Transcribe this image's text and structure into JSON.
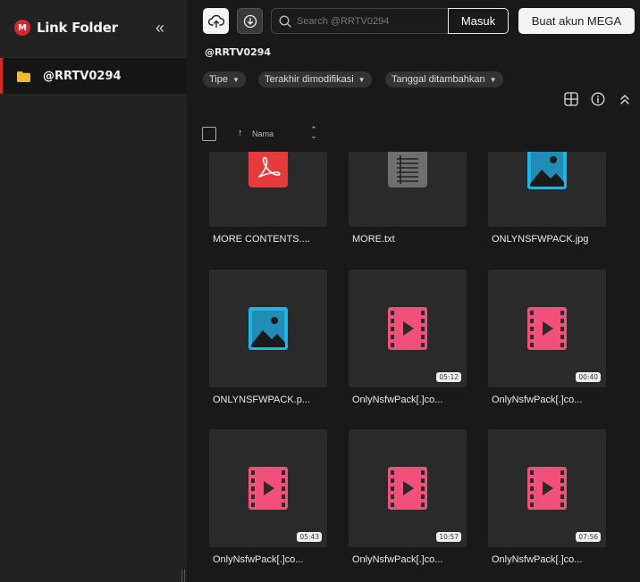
{
  "sidebar": {
    "brand_logo": "M",
    "brand_title": "Link Folder",
    "collapse_glyph": "«",
    "items": [
      {
        "label": "@RRTV0294",
        "icon": "folder-icon"
      }
    ]
  },
  "header": {
    "search_placeholder": "Search @RRTV0294",
    "login_label": "Masuk",
    "signup_label": "Buat akun MEGA"
  },
  "path_title": "@RRTV0294",
  "filters": [
    {
      "label": "Tipe"
    },
    {
      "label": "Terakhir dimodifikasi"
    },
    {
      "label": "Tanggal ditambahkan"
    }
  ],
  "list_header": {
    "sort_label": "Nama"
  },
  "files": [
    {
      "name": "MORE CONTENTS....",
      "type": "pdf",
      "duration": ""
    },
    {
      "name": "MORE.txt",
      "type": "txt",
      "duration": ""
    },
    {
      "name": "ONLYNSFWPACK.jpg",
      "type": "image",
      "duration": ""
    },
    {
      "name": "ONLYNSFWPACK.p...",
      "type": "image",
      "duration": ""
    },
    {
      "name": "OnlyNsfwPack[.]co...",
      "type": "video",
      "duration": "05:12"
    },
    {
      "name": "OnlyNsfwPack[.]co...",
      "type": "video",
      "duration": "00:40"
    },
    {
      "name": "OnlyNsfwPack[.]co...",
      "type": "video",
      "duration": "05:43"
    },
    {
      "name": "OnlyNsfwPack[.]co...",
      "type": "video",
      "duration": "10:57"
    },
    {
      "name": "OnlyNsfwPack[.]co...",
      "type": "video",
      "duration": "07:56"
    }
  ],
  "colors": {
    "accent": "#d9272e",
    "pdf": "#e63b3b",
    "image": "#20b3e8",
    "video": "#f0507a",
    "txt": "#6f6f6f",
    "folder": "#f5b72c"
  }
}
